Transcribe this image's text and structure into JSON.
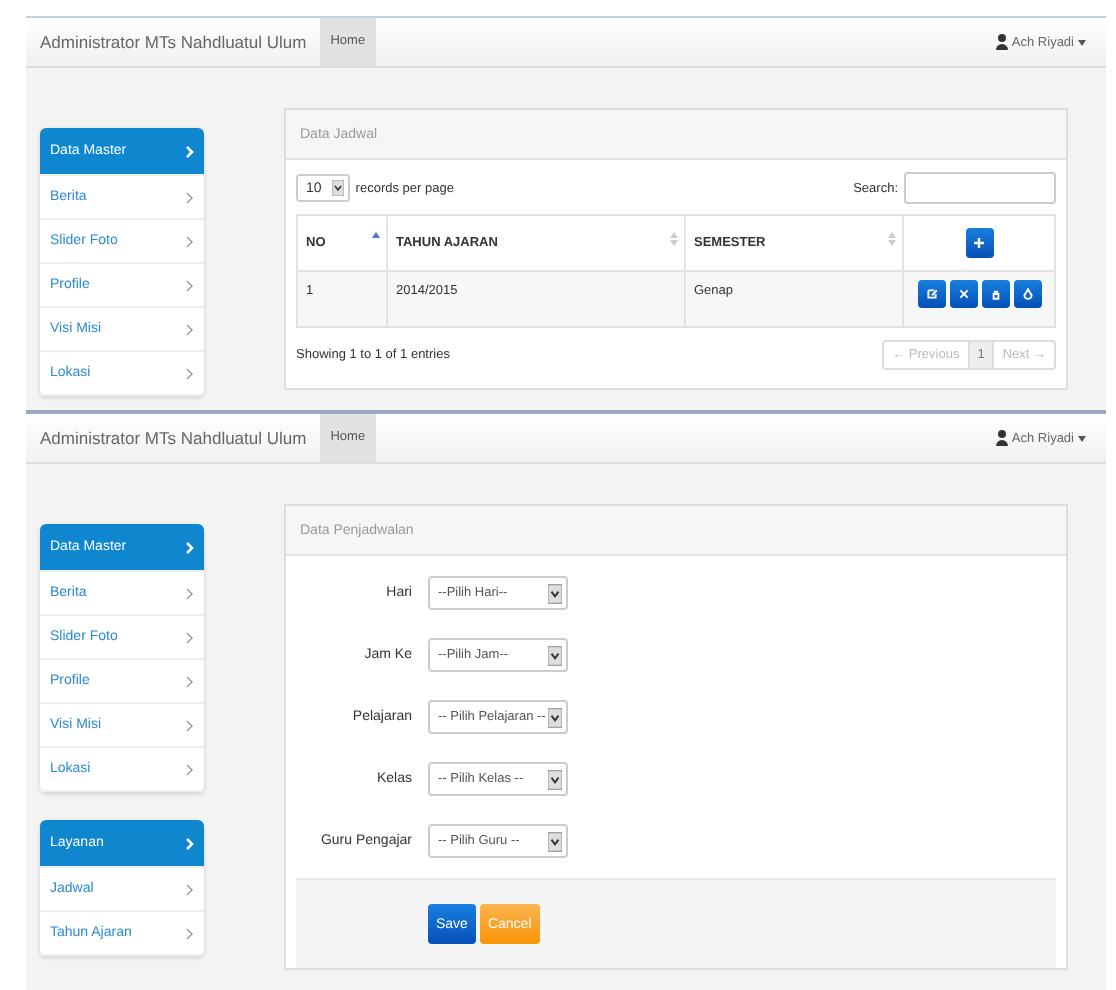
{
  "screens": [
    {
      "kind": "table",
      "navbar": {
        "brand": "Administrator MTs Nahdluatul Ulum",
        "nav_items": [
          {
            "label": "Home",
            "selected": true
          }
        ],
        "user": "Ach Riyadi"
      },
      "sidebar_groups": [
        {
          "items": [
            {
              "label": "Data Master",
              "selected": true
            },
            {
              "label": "Berita",
              "selected": false
            },
            {
              "label": "Slider Foto",
              "selected": false
            },
            {
              "label": "Profile",
              "selected": false
            },
            {
              "label": "Visi Misi",
              "selected": false
            },
            {
              "label": "Lokasi",
              "selected": false
            }
          ]
        }
      ],
      "panel": {
        "title": "Data Jadwal",
        "page_size": "10",
        "page_size_label": "records per page",
        "search_label": "Search:",
        "columns": [
          {
            "label": "NO",
            "sorted": true
          },
          {
            "label": "TAHUN AJARAN",
            "sorted": false
          },
          {
            "label": "SEMESTER",
            "sorted": false
          }
        ],
        "rows": [
          {
            "cells": [
              "1",
              "2014/2015",
              "Genap"
            ],
            "actions": [
              {
                "kind": "edit"
              },
              {
                "kind": "delete"
              },
              {
                "kind": "lock"
              },
              {
                "kind": "drop"
              }
            ]
          }
        ],
        "info": "Showing 1 to 1 of 1 entries",
        "pagination": [
          {
            "label": "← Previous",
            "selected": false,
            "disabled": true
          },
          {
            "label": "1",
            "selected": true,
            "disabled": false
          },
          {
            "label": "Next →",
            "selected": false,
            "disabled": true
          }
        ]
      }
    },
    {
      "kind": "form",
      "navbar": {
        "brand": "Administrator MTs Nahdluatul Ulum",
        "nav_items": [
          {
            "label": "Home",
            "selected": true
          }
        ],
        "user": "Ach Riyadi"
      },
      "sidebar_groups": [
        {
          "items": [
            {
              "label": "Data Master",
              "selected": true
            },
            {
              "label": "Berita",
              "selected": false
            },
            {
              "label": "Slider Foto",
              "selected": false
            },
            {
              "label": "Profile",
              "selected": false
            },
            {
              "label": "Visi Misi",
              "selected": false
            },
            {
              "label": "Lokasi",
              "selected": false
            }
          ]
        },
        {
          "items": [
            {
              "label": "Layanan",
              "selected": true
            },
            {
              "label": "Jadwal",
              "selected": false
            },
            {
              "label": "Tahun Ajaran",
              "selected": false
            }
          ]
        }
      ],
      "panel": {
        "title": "Data Penjadwalan",
        "fields": [
          {
            "label": "Hari",
            "value": "--Pilih Hari--"
          },
          {
            "label": "Jam Ke",
            "value": "--Pilih Jam--"
          },
          {
            "label": "Pelajaran",
            "value": "-- Pilih Pelajaran --"
          },
          {
            "label": "Kelas",
            "value": "-- Pilih Kelas --"
          },
          {
            "label": "Guru Pengajar",
            "value": "-- Pilih Guru --"
          }
        ],
        "buttons": [
          {
            "label": "Save",
            "kind": "primary"
          },
          {
            "label": "Cancel",
            "kind": "warning"
          }
        ]
      }
    }
  ]
}
